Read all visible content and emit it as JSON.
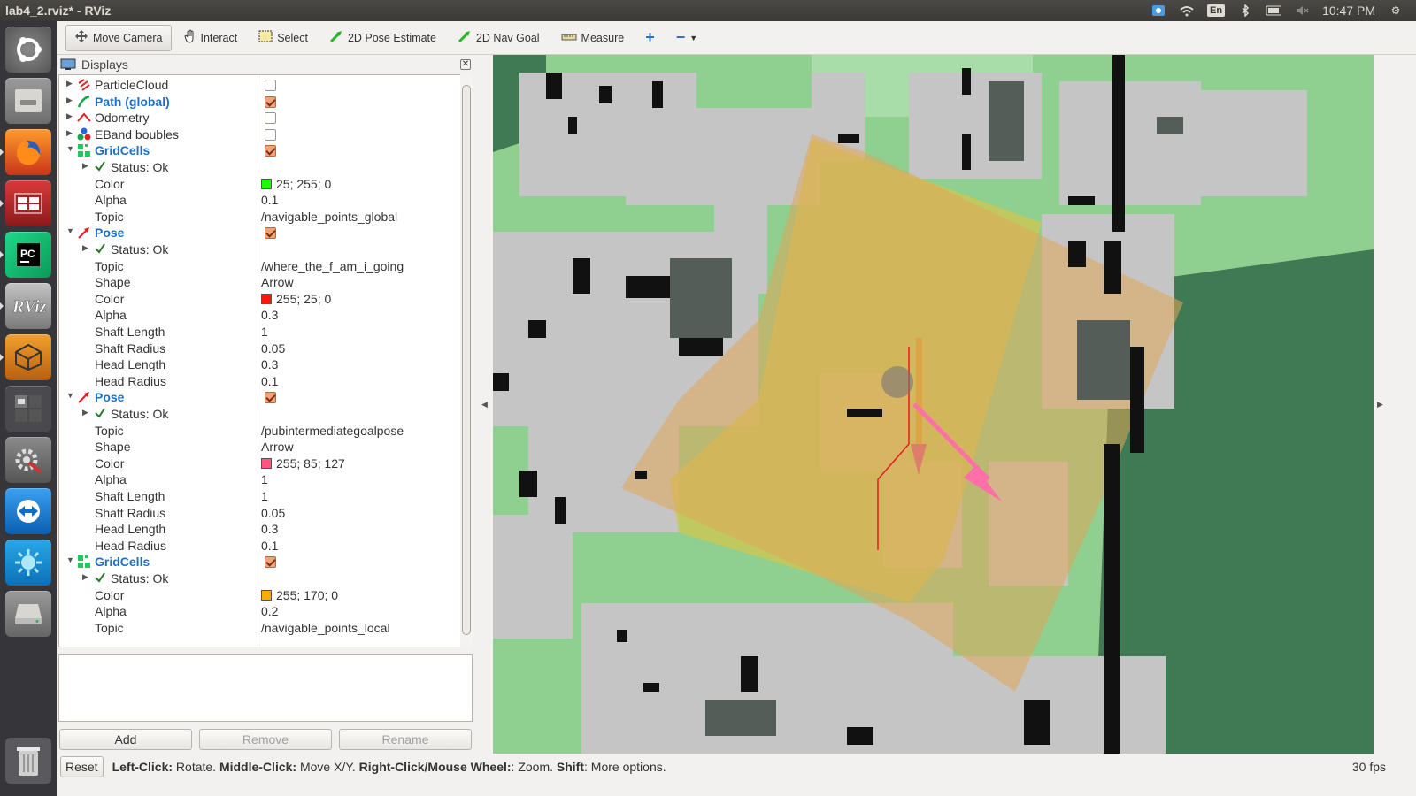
{
  "window": {
    "title": "lab4_2.rviz* - RViz"
  },
  "tray": {
    "time": "10:47 PM",
    "keyboard": "En",
    "icons": [
      "chat-icon",
      "wifi-icon",
      "keyboard-icon",
      "bluetooth-icon",
      "battery-icon",
      "volume-icon"
    ]
  },
  "launcher": {
    "apps": [
      "ubuntu-dash",
      "files",
      "firefox",
      "terminal",
      "pycharm",
      "rviz",
      "sketchup",
      "workspace-switcher",
      "settings",
      "teamviewer",
      "app-blue",
      "disks"
    ]
  },
  "toolbar": {
    "tools": [
      {
        "label": "Move Camera",
        "active": true,
        "icon": "move-camera-icon"
      },
      {
        "label": "Interact",
        "active": false,
        "icon": "hand-icon"
      },
      {
        "label": "Select",
        "active": false,
        "icon": "select-icon"
      },
      {
        "label": "2D Pose Estimate",
        "active": false,
        "icon": "green-arrow-icon"
      },
      {
        "label": "2D Nav Goal",
        "active": false,
        "icon": "green-arrow-icon"
      },
      {
        "label": "Measure",
        "active": false,
        "icon": "ruler-icon"
      }
    ]
  },
  "panel": {
    "title": "Displays",
    "rows": [
      {
        "depth": 0,
        "arrow": "▶",
        "icon": "particlecloud-icon",
        "name": "ParticleCloud",
        "blue": false,
        "check": false
      },
      {
        "depth": 0,
        "arrow": "▶",
        "icon": "path-icon",
        "name": "Path (global)",
        "blue": true,
        "check": true
      },
      {
        "depth": 0,
        "arrow": "▶",
        "icon": "odometry-icon",
        "name": "Odometry",
        "blue": false,
        "check": false
      },
      {
        "depth": 0,
        "arrow": "▶",
        "icon": "marker-icon",
        "name": "EBand boubles",
        "blue": false,
        "check": false
      },
      {
        "depth": 0,
        "arrow": "▼",
        "icon": "gridcells-icon",
        "name": "GridCells",
        "blue": true,
        "check": true
      },
      {
        "depth": 1,
        "arrow": "▶",
        "icon": "check-icon",
        "name": "Status: Ok",
        "status": true
      },
      {
        "depth": 1,
        "name": "Color",
        "value": "25; 255; 0",
        "swatch": "#19ff00"
      },
      {
        "depth": 1,
        "name": "Alpha",
        "value": "0.1"
      },
      {
        "depth": 1,
        "name": "Topic",
        "value": "/navigable_points_global"
      },
      {
        "depth": 0,
        "arrow": "▼",
        "icon": "pose-icon",
        "name": "Pose",
        "blue": true,
        "check": true
      },
      {
        "depth": 1,
        "arrow": "▶",
        "icon": "check-icon",
        "name": "Status: Ok",
        "status": true
      },
      {
        "depth": 1,
        "name": "Topic",
        "value": "/where_the_f_am_i_going"
      },
      {
        "depth": 1,
        "name": "Shape",
        "value": "Arrow"
      },
      {
        "depth": 1,
        "name": "Color",
        "value": "255; 25; 0",
        "swatch": "#ff1900"
      },
      {
        "depth": 1,
        "name": "Alpha",
        "value": "0.3"
      },
      {
        "depth": 1,
        "name": "Shaft Length",
        "value": "1"
      },
      {
        "depth": 1,
        "name": "Shaft Radius",
        "value": "0.05"
      },
      {
        "depth": 1,
        "name": "Head Length",
        "value": "0.3"
      },
      {
        "depth": 1,
        "name": "Head Radius",
        "value": "0.1"
      },
      {
        "depth": 0,
        "arrow": "▼",
        "icon": "pose-icon",
        "name": "Pose",
        "blue": true,
        "check": true
      },
      {
        "depth": 1,
        "arrow": "▶",
        "icon": "check-icon",
        "name": "Status: Ok",
        "status": true
      },
      {
        "depth": 1,
        "name": "Topic",
        "value": "/pubintermediategoalpose"
      },
      {
        "depth": 1,
        "name": "Shape",
        "value": "Arrow"
      },
      {
        "depth": 1,
        "name": "Color",
        "value": "255; 85; 127",
        "swatch": "#ff557f"
      },
      {
        "depth": 1,
        "name": "Alpha",
        "value": "1"
      },
      {
        "depth": 1,
        "name": "Shaft Length",
        "value": "1"
      },
      {
        "depth": 1,
        "name": "Shaft Radius",
        "value": "0.05"
      },
      {
        "depth": 1,
        "name": "Head Length",
        "value": "0.3"
      },
      {
        "depth": 1,
        "name": "Head Radius",
        "value": "0.1"
      },
      {
        "depth": 0,
        "arrow": "▼",
        "icon": "gridcells-icon",
        "name": "GridCells",
        "blue": true,
        "check": true
      },
      {
        "depth": 1,
        "arrow": "▶",
        "icon": "check-icon",
        "name": "Status: Ok",
        "status": true
      },
      {
        "depth": 1,
        "name": "Color",
        "value": "255; 170; 0",
        "swatch": "#ffaa00"
      },
      {
        "depth": 1,
        "name": "Alpha",
        "value": "0.2"
      },
      {
        "depth": 1,
        "name": "Topic",
        "value": "/navigable_points_local"
      }
    ],
    "buttons": {
      "add": "Add",
      "remove": "Remove",
      "rename": "Rename"
    }
  },
  "status": {
    "reset": "Reset",
    "hint": [
      {
        "b": "Left-Click:",
        "t": " Rotate. "
      },
      {
        "b": "Middle-Click:",
        "t": " Move X/Y. "
      },
      {
        "b": "Right-Click/Mouse Wheel:",
        "t": ": Zoom. "
      },
      {
        "b": "Shift",
        "t": ": More options."
      }
    ],
    "fps": "30 fps"
  },
  "colors": {
    "map_free": "#8fcf8f",
    "map_inflated": "#c5c5c5",
    "map_unknown": "#3f7a55",
    "map_obstacle": "#111111",
    "global_cells": "#c8c85a",
    "local_cells": "#e0b070",
    "pose1": "#e0a040",
    "pose2": "#ff6fa8",
    "path": "#e02020"
  }
}
